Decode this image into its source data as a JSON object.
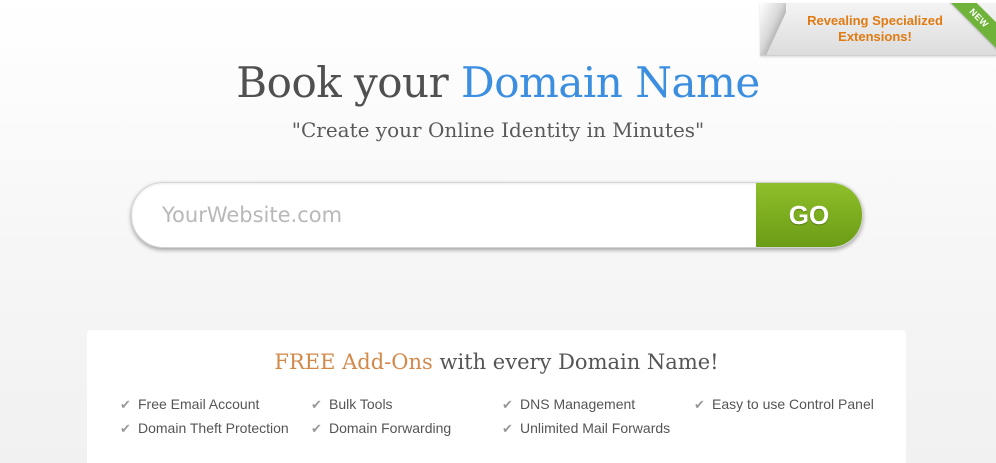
{
  "promo": {
    "line1": "Revealing Specialized",
    "line2": "Extensions!",
    "badge": "NEW"
  },
  "hero": {
    "title_main": "Book your",
    "title_accent": "Domain Name",
    "tagline": "\"Create your Online Identity in Minutes\""
  },
  "search": {
    "placeholder": "YourWebsite.com",
    "go_label": "GO"
  },
  "addons": {
    "title_highlight": "FREE Add-Ons",
    "title_rest": "with every Domain Name!",
    "features": [
      "Free Email Account",
      "Bulk Tools",
      "DNS Management",
      "Easy to use Control Panel",
      "Domain Theft Protection",
      "Domain Forwarding",
      "Unlimited Mail Forwards"
    ]
  },
  "colors": {
    "accent_blue": "#3b8ee0",
    "go_green": "#7aad20",
    "promo_orange": "#e07a12",
    "free_orange": "#d3894a"
  },
  "icons": {
    "feature_check": "check-icon"
  }
}
